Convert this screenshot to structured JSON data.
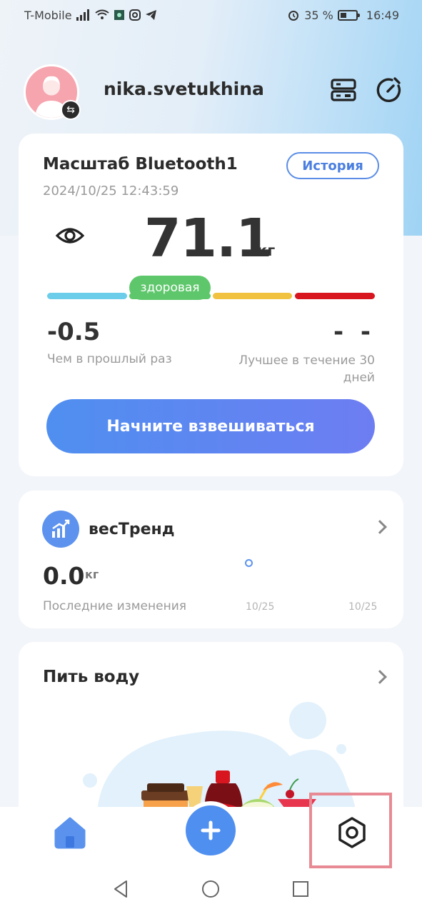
{
  "status_bar": {
    "carrier": "T-Mobile",
    "battery_percent": "35 %",
    "time": "16:49",
    "icons": [
      "signal-icon",
      "wifi-icon",
      "app-icon",
      "instagram-icon",
      "telegram-icon",
      "alarm-icon",
      "battery-icon"
    ]
  },
  "header": {
    "username": "nika.svetukhina",
    "icons": [
      "avatar",
      "switch-user-icon",
      "devices-icon",
      "refresh-icon"
    ]
  },
  "scale_card": {
    "title": "Масштаб Bluetooth1",
    "date": "2024/10/25 12:43:59",
    "history_label": "История",
    "weight": "71.1",
    "unit": "кг",
    "status_label": "здоровая",
    "bar_colors": [
      "#6ccdea",
      "#f1c240",
      "#d7161f"
    ],
    "diff_value": "-0.5",
    "diff_label": "Чем в прошлый раз",
    "best_value": "- -",
    "best_label": "Лучшее в течение 30 дней",
    "start_button": "Начните взвешиваться"
  },
  "trend_card": {
    "title": "весТренд",
    "value": "0.0",
    "unit": "кг",
    "label": "Последние изменения",
    "dates": [
      "10/25",
      "10/25"
    ]
  },
  "water_card": {
    "title": "Пить воду"
  },
  "bottom_nav": {
    "items": [
      "home-icon",
      "add-icon",
      "settings-icon"
    ],
    "accent": "#4f8ff0",
    "highlight_color": "#e88a93"
  }
}
